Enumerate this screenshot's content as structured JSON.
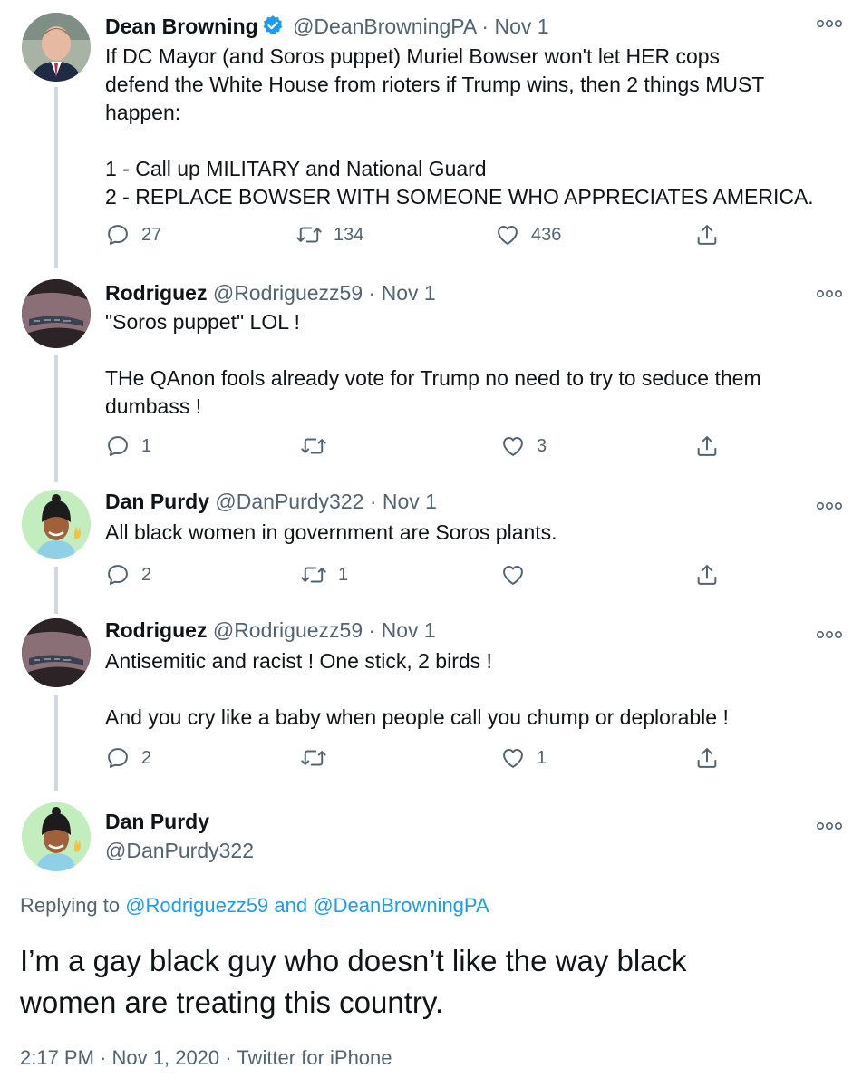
{
  "tweets": [
    {
      "name": "Dean Browning",
      "handle": "@DeanBrowningPA",
      "sep": "·",
      "date": "Nov 1",
      "text": "If DC Mayor (and Soros puppet) Muriel Bowser won't let HER cops\ndefend the White House from rioters if Trump wins, then 2 things MUST\nhappen:\n\n1 - Call up MILITARY and National Guard\n2 - REPLACE BOWSER WITH SOMEONE WHO APPRECIATES AMERICA.",
      "replies": "27",
      "retweets": "134",
      "likes": "436"
    },
    {
      "name": "Rodriguez",
      "handle": "@Rodriguezz59",
      "sep": "·",
      "date": "Nov 1",
      "text": "\"Soros puppet\" LOL !\n\nTHe QAnon fools already vote for Trump no need to try to seduce them\ndumbass !",
      "replies": "1",
      "retweets": "",
      "likes": "3"
    },
    {
      "name": "Dan Purdy",
      "handle": "@DanPurdy322",
      "sep": "·",
      "date": "Nov 1",
      "text": "All black women in government are Soros plants.",
      "replies": "2",
      "retweets": "1",
      "likes": ""
    },
    {
      "name": "Rodriguez",
      "handle": "@Rodriguezz59",
      "sep": "·",
      "date": "Nov 1",
      "text": "Antisemitic and racist ! One stick, 2 birds !\n\nAnd you cry like a baby when people call you chump or deplorable !",
      "replies": "2",
      "retweets": "",
      "likes": "1"
    }
  ],
  "main": {
    "name": "Dan Purdy",
    "handle": "@DanPurdy322",
    "replying_prefix": "Replying to",
    "replying_to_1": "@Rodriguezz59",
    "replying_and": "and",
    "replying_to_2": "@DeanBrowningPA",
    "text": "I’m a gay black guy who doesn’t like the way black\nwomen are treating this country.",
    "time": "2:17 PM",
    "sep1": "·",
    "date": "Nov 1, 2020",
    "sep2": "·",
    "source": "Twitter for iPhone"
  },
  "icons": {
    "reply": "reply-icon",
    "retweet": "retweet-icon",
    "like": "like-icon",
    "share": "share-icon",
    "more": "more-options-icon",
    "verified": "verified-badge-icon"
  },
  "colors": {
    "link": "#1d9bf0",
    "secondary": "#536471",
    "thread_line": "#cfd9de"
  }
}
